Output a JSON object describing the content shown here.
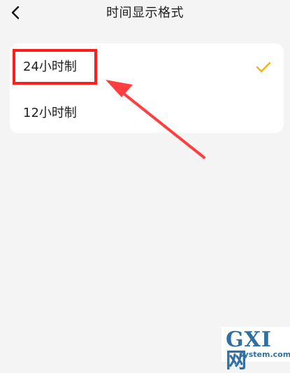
{
  "header": {
    "title": "时间显示格式",
    "back_icon": "chevron-left-icon"
  },
  "options": {
    "items": [
      {
        "label": "24小时制",
        "selected": true
      },
      {
        "label": "12小时制",
        "selected": false
      }
    ]
  },
  "annotation": {
    "highlight_color": "#ff1d1d",
    "arrow_color": "#ff3f3f"
  },
  "colors": {
    "page_background": "#f4f4f4",
    "card_background": "#ffffff",
    "selected_check": "#f2b318",
    "watermark": "#2f6fa4"
  },
  "watermark": {
    "main": "GXI网",
    "sub": "system.com"
  }
}
